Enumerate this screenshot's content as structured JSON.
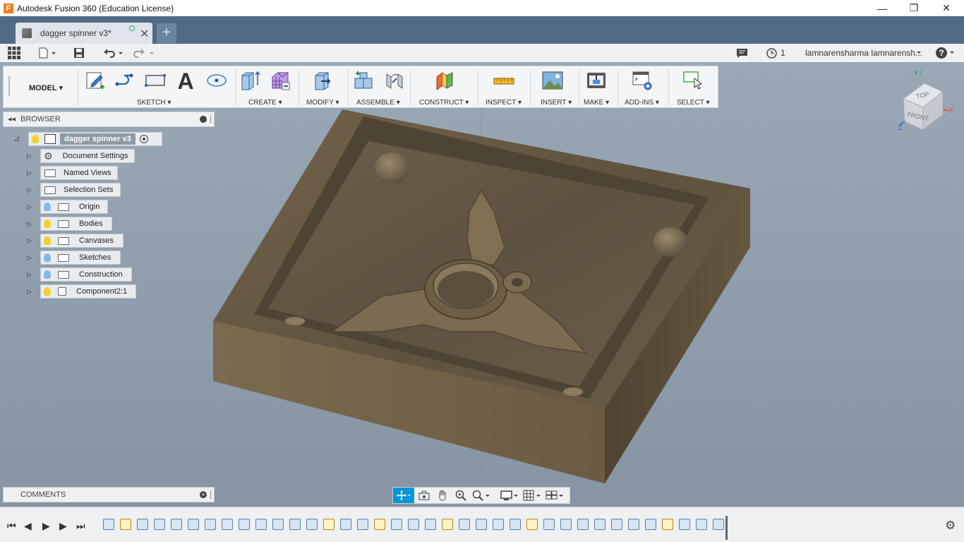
{
  "window": {
    "title": "Autodesk Fusion 360 (Education License)",
    "logo_letter": "F",
    "minimize": "—",
    "restore": "❐",
    "close": "✕"
  },
  "tabs": {
    "document_tab_label": "dagger spinner v3*",
    "new_tab_label": "+"
  },
  "quick_access": {
    "job_count": "1",
    "user_name": "lamnarensharma lamnarensh...",
    "help": "?"
  },
  "toolbar": {
    "workspace": "MODEL ▾",
    "groups": {
      "sketch": "SKETCH ▾",
      "create": "CREATE ▾",
      "modify": "MODIFY ▾",
      "assemble": "ASSEMBLE ▾",
      "construct": "CONSTRUCT ▾",
      "inspect": "INSPECT ▾",
      "insert": "INSERT ▾",
      "make": "MAKE ▾",
      "addins": "ADD-INS ▾",
      "select": "SELECT ▾"
    }
  },
  "browser": {
    "title": "BROWSER",
    "root_label": "dagger spinner v3",
    "items": [
      {
        "label": "Document Settings"
      },
      {
        "label": "Named Views"
      },
      {
        "label": "Selection Sets"
      },
      {
        "label": "Origin"
      },
      {
        "label": "Bodies"
      },
      {
        "label": "Canvases"
      },
      {
        "label": "Sketches"
      },
      {
        "label": "Construction"
      },
      {
        "label": "Component2:1"
      }
    ]
  },
  "comments": {
    "title": "COMMENTS"
  },
  "viewcube": {
    "top": "TOP",
    "front": "FRONT",
    "axis_x": "X",
    "axis_y": "Y",
    "axis_z": "Z"
  },
  "colors": {
    "tab_bar": "#4e6a85",
    "viewport": "#8d9cab",
    "bulb_on": "#f5cf2c",
    "bulb_off": "#86b6e6",
    "accent": "#0696d7"
  }
}
